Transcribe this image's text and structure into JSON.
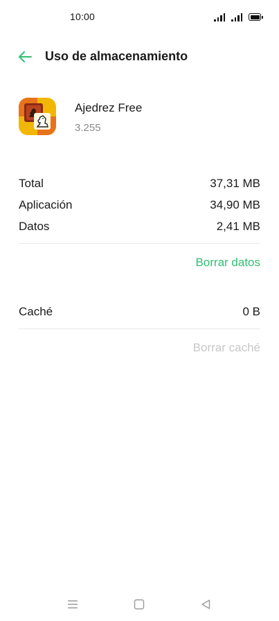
{
  "status_bar": {
    "time": "10:00",
    "icons": [
      "signal-icon",
      "signal-icon",
      "battery-icon"
    ]
  },
  "header": {
    "title": "Uso de almacenamiento",
    "back_icon": "arrow-left-icon"
  },
  "colors": {
    "accent": "#2fbf71",
    "disabled": "#c8c8c8",
    "secondary_text": "#8a8a8a"
  },
  "app": {
    "name": "Ajedrez Free",
    "version": "3.255",
    "icon": "chess-app-icon"
  },
  "storage": {
    "rows": [
      {
        "label": "Total",
        "value": "37,31 MB"
      },
      {
        "label": "Aplicación",
        "value": "34,90 MB"
      },
      {
        "label": "Datos",
        "value": "2,41 MB"
      }
    ],
    "clear_data_label": "Borrar datos"
  },
  "cache": {
    "label": "Caché",
    "value": "0 B",
    "clear_cache_label": "Borrar caché"
  },
  "nav_bar": {
    "icons": [
      "menu-icon",
      "home-icon",
      "back-triangle-icon"
    ]
  }
}
